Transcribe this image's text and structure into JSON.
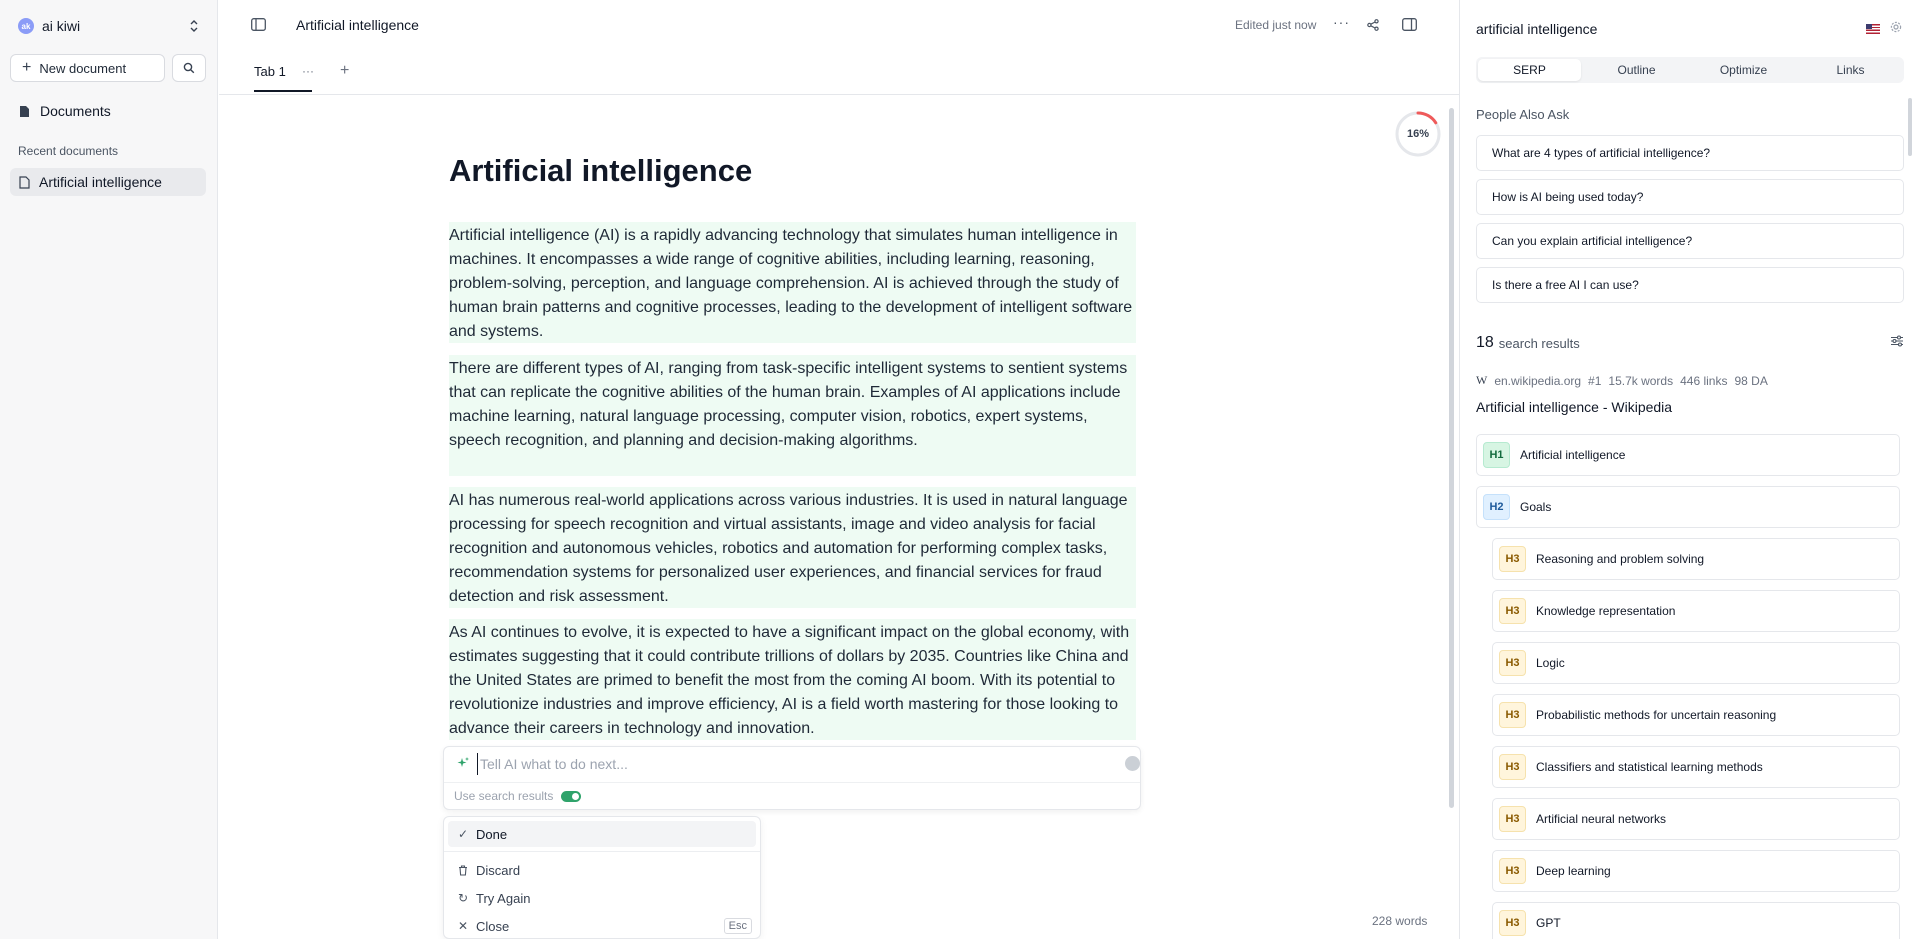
{
  "sidebar": {
    "workspace_avatar": "ak",
    "workspace_name": "ai kiwi",
    "new_document": "New document",
    "documents": "Documents",
    "recent_label": "Recent documents",
    "recent_items": [
      "Artificial intelligence"
    ]
  },
  "topbar": {
    "doc_title": "Artificial intelligence",
    "edited": "Edited just now"
  },
  "tabs": {
    "tab1": "Tab 1"
  },
  "editor": {
    "progress": "16%",
    "progress_value": 0.16,
    "title": "Artificial intelligence",
    "paragraphs": [
      "Artificial intelligence (AI) is a rapidly advancing technology that simulates human intelligence in machines. It encompasses a wide range of cognitive abilities, including learning, reasoning, problem-solving, perception, and language comprehension. AI is achieved through the study of human brain patterns and cognitive processes, leading to the development of intelligent software and systems.",
      "There are different types of AI, ranging from task-specific intelligent systems to sentient systems that can replicate the cognitive abilities of the human brain. Examples of AI applications include machine learning, natural language processing, computer vision, robotics, expert systems, speech recognition, and planning and decision-making algorithms.",
      "AI has numerous real-world applications across various industries. It is used in natural language processing for speech recognition and virtual assistants, image and video analysis for facial recognition and autonomous vehicles, robotics and automation for performing complex tasks, recommendation systems for personalized user experiences, and financial services for fraud detection and risk assessment.",
      "As AI continues to evolve, it is expected to have a significant impact on the global economy, with estimates suggesting that it could contribute trillions of dollars by 2035. Countries like China and the United States are primed to benefit the most from the coming AI boom. With its potential to revolutionize industries and improve efficiency, AI is a field worth mastering for those looking to advance their careers in technology and innovation."
    ],
    "ai_placeholder": "Tell AI what to do next...",
    "ai_value": "",
    "use_search_results": "Use search results",
    "menu": {
      "done": "Done",
      "discard": "Discard",
      "try_again": "Try Again",
      "close": "Close",
      "close_shortcut": "Esc"
    },
    "word_count": "228 words"
  },
  "right": {
    "keyword": "artificial intelligence",
    "tabs": [
      "SERP",
      "Outline",
      "Optimize",
      "Links"
    ],
    "active_tab": "SERP",
    "paa_title": "People Also Ask",
    "paa": [
      "What are 4 types of artificial intelligence?",
      "How is AI being used today?",
      "Can you explain artificial intelligence?",
      "Is there a free AI I can use?"
    ],
    "results_count": "18",
    "results_label": "search results",
    "source": {
      "domain": "en.wikipedia.org",
      "rank": "#1",
      "words": "15.7k words",
      "links": "446 links",
      "da": "98 DA",
      "title": "Artificial intelligence - Wikipedia"
    },
    "headings": [
      {
        "level": "H1",
        "text": "Artificial intelligence"
      },
      {
        "level": "H2",
        "text": "Goals"
      },
      {
        "level": "H3",
        "text": "Reasoning and problem solving"
      },
      {
        "level": "H3",
        "text": "Knowledge representation"
      },
      {
        "level": "H3",
        "text": "Logic"
      },
      {
        "level": "H3",
        "text": "Probabilistic methods for uncertain reasoning"
      },
      {
        "level": "H3",
        "text": "Classifiers and statistical learning methods"
      },
      {
        "level": "H3",
        "text": "Artificial neural networks"
      },
      {
        "level": "H3",
        "text": "Deep learning"
      },
      {
        "level": "H3",
        "text": "GPT"
      }
    ]
  }
}
